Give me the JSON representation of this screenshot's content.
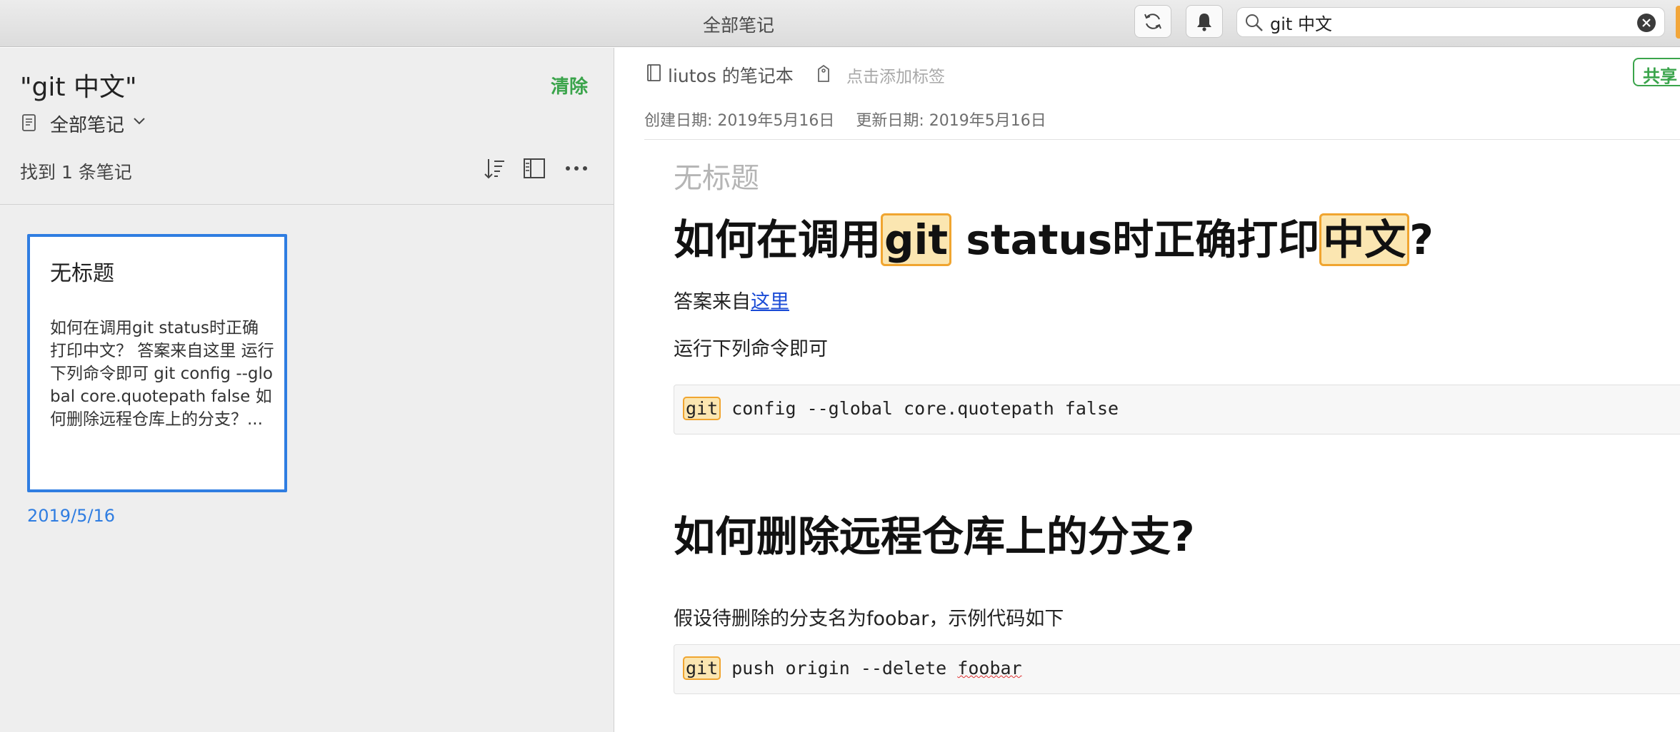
{
  "window": {
    "title": "全部笔记"
  },
  "toolbar": {
    "sync_icon": "sync-icon",
    "bell_icon": "bell-icon"
  },
  "search": {
    "value": "git 中文",
    "placeholder": ""
  },
  "list": {
    "query": "\"git 中文\"",
    "clear_label": "清除",
    "scope_label": "全部笔记",
    "count_label": "找到 1 条笔记",
    "notes": [
      {
        "title": "无标题",
        "snippet": "如何在调用git status时正确打印中文？ 答案来自这里 运行下列命令即可 git config --global core.quotepath false 如何删除远程仓库上的分支？...",
        "date": "2019/5/16"
      }
    ]
  },
  "editor": {
    "notebook": "liutos 的笔记本",
    "tag_placeholder": "点击添加标签",
    "share_label": "共享",
    "created": "创建日期: 2019年5月16日",
    "updated": "更新日期: 2019年5月16日",
    "doc_title": "无标题",
    "h1_a": {
      "pre": "如何在调用",
      "hl1": "git",
      "mid": " status时正确打印",
      "hl2": "中文",
      "post": "?"
    },
    "p1": {
      "text": "答案来自",
      "link": "这里"
    },
    "p2": "运行下列命令即可",
    "code1": {
      "hl": "git",
      "rest": " config --global core.quotepath false"
    },
    "h1_b": "如何删除远程仓库上的分支?",
    "p3": "假设待删除的分支名为foobar，示例代码如下",
    "code2": {
      "hl": "git",
      "rest_a": " push origin --delete ",
      "rest_b": "foobar"
    }
  },
  "colors": {
    "accent_green": "#3aa44b",
    "selection_blue": "#2f7de1",
    "highlight": "#fbe6b1",
    "highlight_border": "#f0a530"
  }
}
